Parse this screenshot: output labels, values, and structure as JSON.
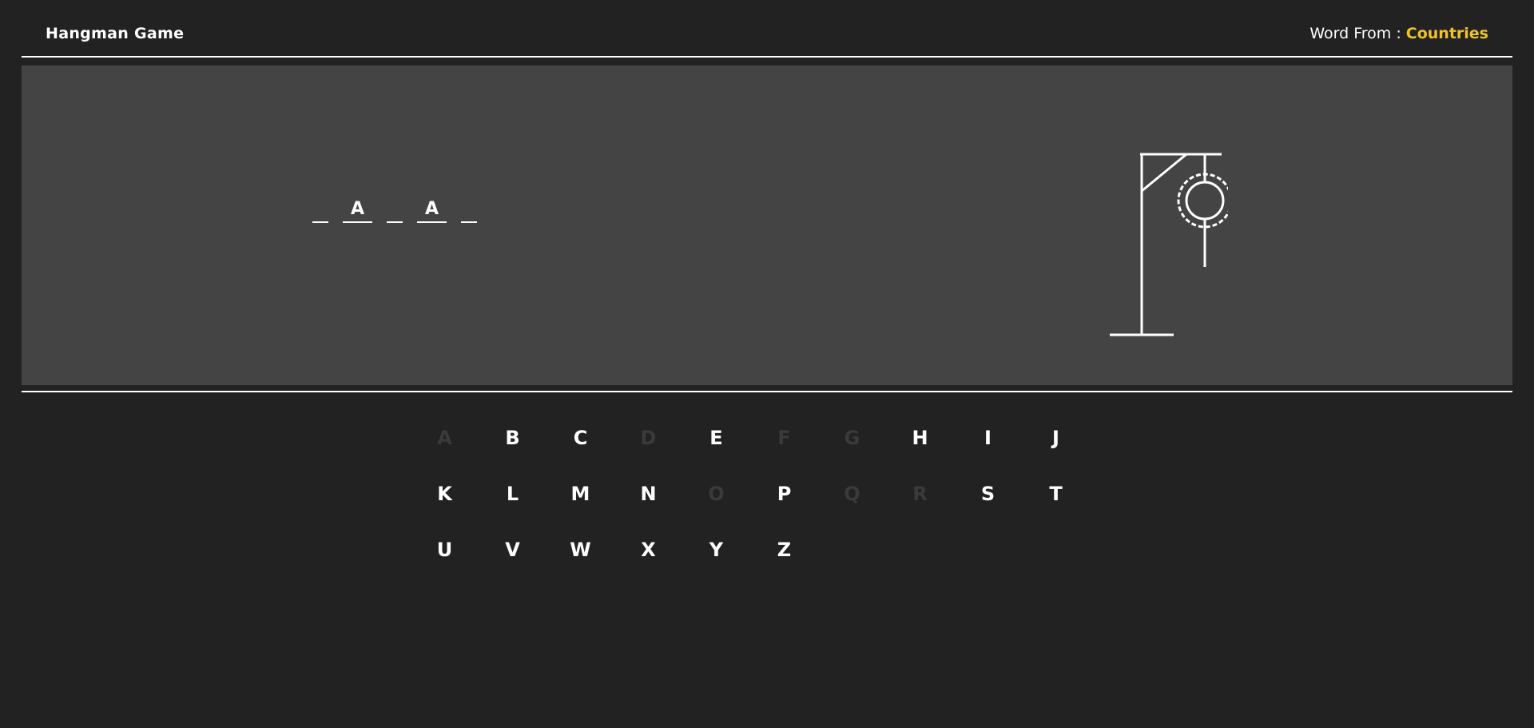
{
  "header": {
    "title": "Hangman Game",
    "word_from_label": "Word From :",
    "category": "Countries"
  },
  "word": {
    "slots": [
      "",
      "A",
      "",
      "A",
      ""
    ]
  },
  "hangman": {
    "stage": "head-and-rope",
    "parts_shown": [
      "base",
      "pole",
      "beam",
      "brace",
      "rope",
      "head"
    ]
  },
  "keyboard": {
    "letters": [
      {
        "letter": "A",
        "used": true
      },
      {
        "letter": "B",
        "used": false
      },
      {
        "letter": "C",
        "used": false
      },
      {
        "letter": "D",
        "used": true
      },
      {
        "letter": "E",
        "used": false
      },
      {
        "letter": "F",
        "used": true
      },
      {
        "letter": "G",
        "used": true
      },
      {
        "letter": "H",
        "used": false
      },
      {
        "letter": "I",
        "used": false
      },
      {
        "letter": "J",
        "used": false
      },
      {
        "letter": "K",
        "used": false
      },
      {
        "letter": "L",
        "used": false
      },
      {
        "letter": "M",
        "used": false
      },
      {
        "letter": "N",
        "used": false
      },
      {
        "letter": "O",
        "used": true
      },
      {
        "letter": "P",
        "used": false
      },
      {
        "letter": "Q",
        "used": true
      },
      {
        "letter": "R",
        "used": true
      },
      {
        "letter": "S",
        "used": false
      },
      {
        "letter": "T",
        "used": false
      },
      {
        "letter": "U",
        "used": false
      },
      {
        "letter": "V",
        "used": false
      },
      {
        "letter": "W",
        "used": false
      },
      {
        "letter": "X",
        "used": false
      },
      {
        "letter": "Y",
        "used": false
      },
      {
        "letter": "Z",
        "used": false
      }
    ]
  },
  "colors": {
    "background": "#222222",
    "board": "#444444",
    "accent": "#f0c22b",
    "used_letter": "#3a3a3a"
  }
}
